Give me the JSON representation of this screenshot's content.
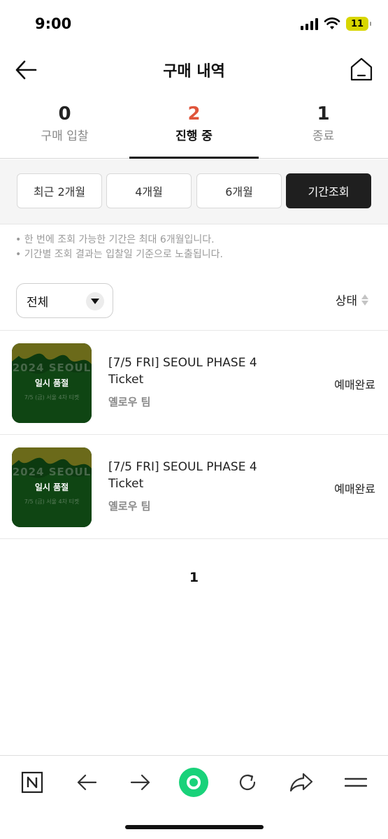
{
  "status_bar": {
    "time": "9:00",
    "battery": "11"
  },
  "header": {
    "title": "구매 내역"
  },
  "tabs": [
    {
      "count": "0",
      "label": "구매 입찰",
      "active": false
    },
    {
      "count": "2",
      "label": "진행 중",
      "active": true
    },
    {
      "count": "1",
      "label": "종료",
      "active": false
    }
  ],
  "period_filters": [
    {
      "label": "최근 2개월",
      "active": false
    },
    {
      "label": "4개월",
      "active": false
    },
    {
      "label": "6개월",
      "active": false
    },
    {
      "label": "기간조회",
      "active": true
    }
  ],
  "notices": [
    "• 한 번에 조회 가능한 기간은 최대 6개월입니다.",
    "• 기간별 조회 결과는 입찰일 기준으로 노출됩니다."
  ],
  "filter": {
    "selected": "전체",
    "sort_label": "상태"
  },
  "items": [
    {
      "thumb_title": "2024 SEOUL",
      "thumb_badge": "일시 품절",
      "thumb_sub": "7/5 (금) 서울 4차 티켓",
      "title": "[7/5 FRI] SEOUL PHASE 4 Ticket",
      "seller": "옐로우 팀",
      "status": "예매완료"
    },
    {
      "thumb_title": "2024 SEOUL",
      "thumb_badge": "일시 품절",
      "thumb_sub": "7/5 (금) 서울 4차 티켓",
      "title": "[7/5 FRI] SEOUL PHASE 4 Ticket",
      "seller": "옐로우 팀",
      "status": "예매완료"
    }
  ],
  "pagination": {
    "current": "1"
  },
  "colors": {
    "accent": "#e0553b",
    "active_button": "#1f1f1f",
    "browser_green": "#19d27a"
  },
  "bottom_bar": {
    "icons": [
      "naver-n-icon",
      "back-arrow-icon",
      "forward-arrow-icon",
      "home-circle-icon",
      "refresh-icon",
      "share-icon",
      "menu-icon"
    ]
  }
}
